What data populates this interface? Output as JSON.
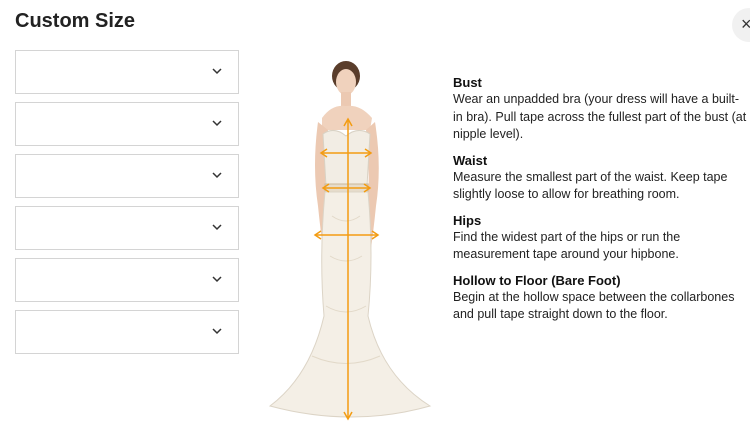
{
  "dialog": {
    "title": "Custom Size",
    "close_label": "×"
  },
  "selects": [
    {
      "value": "",
      "icon": "chevron-down-icon"
    },
    {
      "value": "",
      "icon": "chevron-down-icon"
    },
    {
      "value": "",
      "icon": "chevron-down-icon"
    },
    {
      "value": "",
      "icon": "chevron-down-icon"
    },
    {
      "value": "",
      "icon": "chevron-down-icon"
    },
    {
      "value": "",
      "icon": "chevron-down-icon"
    }
  ],
  "guide": {
    "accent_color": "#f39c12",
    "sections": [
      {
        "heading": "Bust",
        "text": "Wear an unpadded bra (your dress will have a built-in bra). Pull tape across the fullest part of the bust (at nipple level)."
      },
      {
        "heading": "Waist",
        "text": "Measure the smallest part of the waist. Keep tape slightly loose to allow for breathing room."
      },
      {
        "heading": "Hips",
        "text": "Find the widest part of the hips or run the measurement tape around your hipbone."
      },
      {
        "heading": "Hollow to Floor (Bare Foot)",
        "text": "Begin at the hollow space between the collarbones and pull tape straight down to the floor."
      }
    ]
  }
}
